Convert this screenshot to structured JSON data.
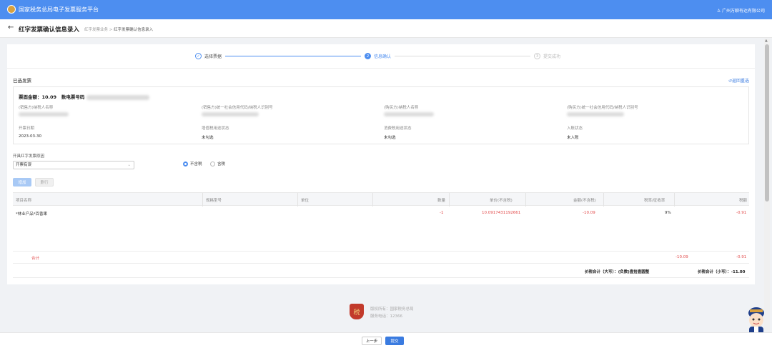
{
  "app": {
    "title": "国家税务总局电子发票服务平台",
    "user": "广州万聊有达有限公司"
  },
  "header": {
    "title": "红字发票确认信息录入",
    "breadcrumb": [
      "红字发票业务",
      "红字发票确认信息录入"
    ]
  },
  "steps": [
    {
      "num": "✓",
      "label": "选择票据"
    },
    {
      "num": "2",
      "label": "信息确认"
    },
    {
      "num": "3",
      "label": "提交成功"
    }
  ],
  "selected": {
    "title": "已选发票",
    "reselect": "返回重选",
    "amount_label": "票面金额：",
    "amount": "10.09",
    "number_label": "数电票号码",
    "fields": [
      {
        "label": "(销售方)纳税人名称",
        "value": ""
      },
      {
        "label": "(销售方)统一社会信用代码/纳税人识别号",
        "value": ""
      },
      {
        "label": "(购买方)纳税人名称",
        "value": ""
      },
      {
        "label": "(购买方)统一社会信用代码/纳税人识别号",
        "value": ""
      },
      {
        "label": "开票日期",
        "value": "2023-03-30"
      },
      {
        "label": "增值税用途状态",
        "value": "未勾选"
      },
      {
        "label": "消费税用途状态",
        "value": "未勾选"
      },
      {
        "label": "入账状态",
        "value": "未入账"
      }
    ]
  },
  "form": {
    "reason_label": "开具红字发票原因",
    "reason_value": "开票有误",
    "tax_options": [
      "不含税",
      "含税"
    ],
    "add_btn": "增加",
    "del_btn": "删行"
  },
  "table": {
    "headers": [
      "项目名称",
      "规格型号",
      "单位",
      "数量",
      "单价(不含税)",
      "金额(不含税)",
      "税率/征收率",
      "税额"
    ],
    "rows": [
      [
        "*林业产品*百香果",
        "",
        "",
        "-1",
        "10.0917431192661",
        "-10.09",
        "9%",
        "-0.91"
      ]
    ],
    "total_label": "合计",
    "total_amount": "-10.09",
    "total_tax": "-0.91",
    "grand_upper_label": "价税合计（大写）：",
    "grand_upper": "(负数)壹拾壹圆整",
    "grand_lower_label": "价税合计（小写）：",
    "grand_lower": "-11.00"
  },
  "footer": {
    "host": "版权所有：国家税务总局",
    "hotline": "服务电话：12366"
  },
  "bottom": {
    "prev": "上一步",
    "submit": "提交"
  },
  "colors": {
    "primary": "#4d8ef0",
    "negative": "#e24b4b"
  }
}
